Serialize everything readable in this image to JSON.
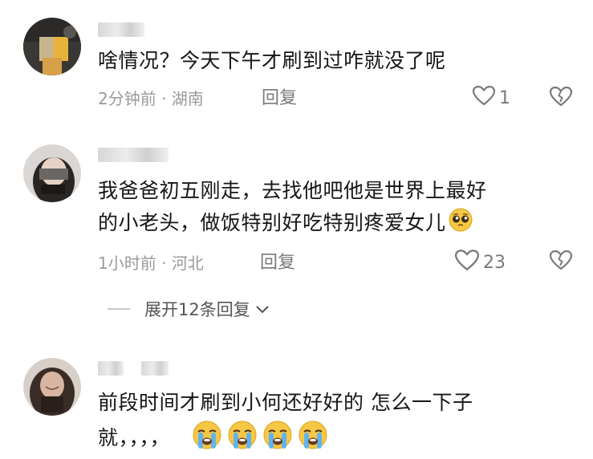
{
  "comments": [
    {
      "text": "啥情况？今天下午才刷到过咋就没了呢",
      "meta": "2分钟前 · 湖南",
      "reply": "回复",
      "likes": "1"
    },
    {
      "text_line1": "我爸爸初五刚走，去找他吧他是世界上最好",
      "text_line2": "的小老头，做饭特别好吃特别疼爱女儿",
      "meta": "1小时前 · 河北",
      "reply": "回复",
      "likes": "23",
      "expand_label": "展开12条回复",
      "emoji": "pleading-face-icon"
    },
    {
      "text_line1": "前段时间才刷到小何还好好的 怎么一下子",
      "text_line2": "就，，，，",
      "emoji": "crying-face-icon",
      "emoji_count": 4
    }
  ],
  "colors": {
    "text": "#161616",
    "meta": "#9a9a9a",
    "icon": "#7a7a7a"
  }
}
